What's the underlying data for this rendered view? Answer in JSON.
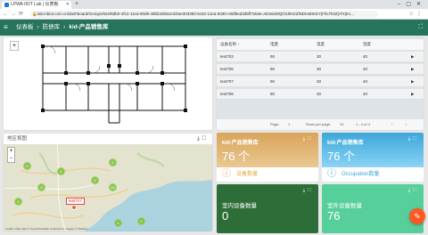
{
  "browser": {
    "tab_title": "LPWA IIOT Lab | 仪表板",
    "new_tab": "+",
    "url": "lab.inbiot.com.cn/dashboard/Groups/82ef8db0-4fc2-11ea-90d9-49bb33b91e33/ae303350-5c52-11ea-9330-c9df8ed3d5ff?state=W3siaWQiOiJkNzZlNDIxMS0zYjFhLTk0ZjYtYjE1..."
  },
  "header": {
    "breadcrumb": [
      "仪表板",
      "防债库",
      "kid-产品销售库"
    ]
  },
  "table": {
    "columns": [
      "设备名称 ↑",
      "电量",
      "温度",
      "湿度"
    ],
    "rows": [
      {
        "name": "test703",
        "power": "90",
        "temp": "30",
        "humidity": "40"
      },
      {
        "name": "test706",
        "power": "90",
        "temp": "30",
        "humidity": "40"
      },
      {
        "name": "test707",
        "power": "90",
        "temp": "30",
        "humidity": "40"
      },
      {
        "name": "test708",
        "power": "90",
        "temp": "30",
        "humidity": "40"
      }
    ],
    "pager": {
      "page_label": "Page:",
      "page": "1",
      "rows_label": "Rows per page:",
      "rows": "10",
      "range": "1 - 4 of 4"
    }
  },
  "map_panel": {
    "title": "地区视图",
    "clusters": [
      "2",
      "6",
      "4",
      "9",
      "8",
      "16",
      "3",
      "2",
      "4"
    ],
    "marker_label": "test727",
    "attribution": "Leaflet | Map data © OpenStreetMap contributors, Imagery © Mapbox"
  },
  "cards": [
    {
      "title": "kid-产品销售库",
      "value": "76 个",
      "footer": "设备数量",
      "color": "#e8a43a"
    },
    {
      "title": "kid-产品销售库",
      "value": "76 个",
      "footer": "Occupation数量",
      "color": "#3aa6dd"
    },
    {
      "title": "室内设备数量",
      "value": "0"
    },
    {
      "title": "室外设备数量",
      "value": "76"
    }
  ]
}
